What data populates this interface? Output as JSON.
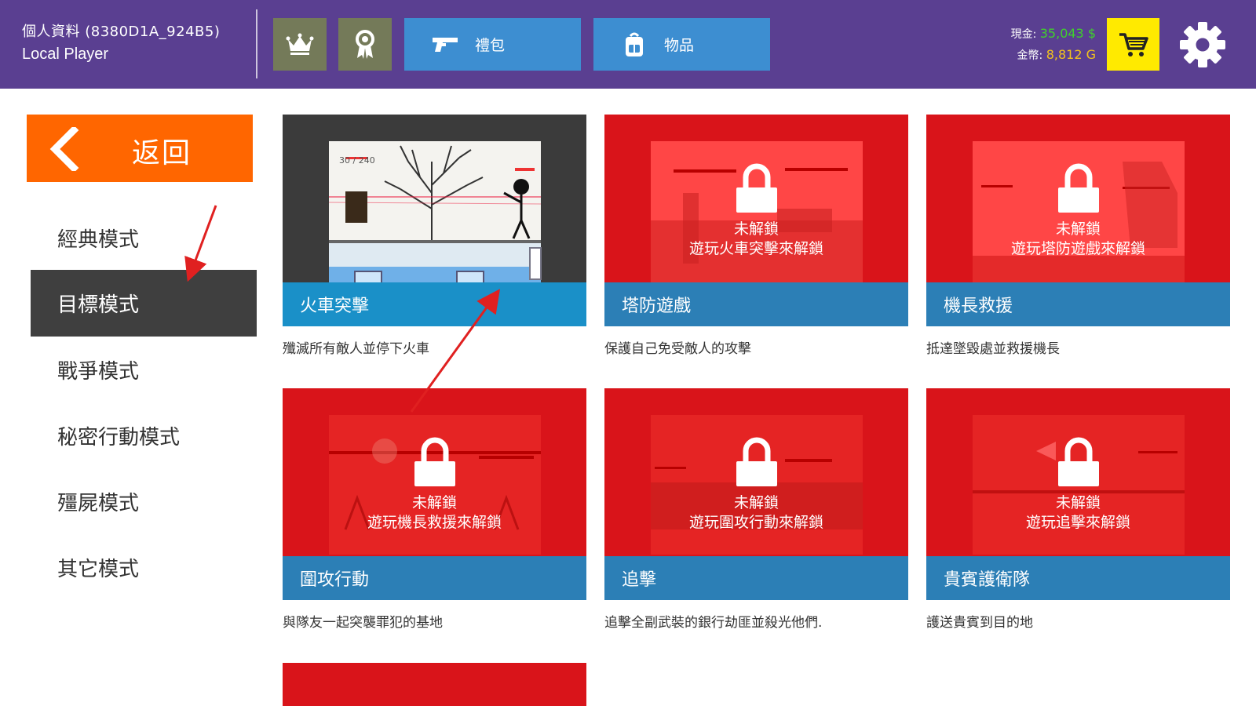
{
  "header": {
    "profile_id": "個人資料 (8380D1A_924B5)",
    "player_name": "Local Player",
    "btn_gift": "禮包",
    "btn_items": "物品",
    "cash_label": "現金:",
    "cash_value": "35,043 $",
    "gold_label": "金幣:",
    "gold_value": "8,812 G"
  },
  "sidebar": {
    "back_label": "返回",
    "items": [
      "經典模式",
      "目標模式",
      "戰爭模式",
      "秘密行動模式",
      "殭屍模式",
      "其它模式"
    ]
  },
  "cards": [
    {
      "title": "火車突擊",
      "desc": "殲滅所有敵人並停下火車",
      "locked": false,
      "art_label": "30 / 240"
    },
    {
      "title": "塔防遊戲",
      "desc": "保護自己免受敵人的攻擊",
      "locked": true,
      "lock_line1": "未解鎖",
      "lock_line2": "遊玩火車突擊來解鎖"
    },
    {
      "title": "機長救援",
      "desc": "抵達墜毀處並救援機長",
      "locked": true,
      "lock_line1": "未解鎖",
      "lock_line2": "遊玩塔防遊戲來解鎖"
    },
    {
      "title": "圍攻行動",
      "desc": "與隊友一起突襲罪犯的基地",
      "locked": true,
      "lock_line1": "未解鎖",
      "lock_line2": "遊玩機長救援來解鎖"
    },
    {
      "title": "追擊",
      "desc": "追擊全副武裝的銀行劫匪並殺光他們.",
      "locked": true,
      "lock_line1": "未解鎖",
      "lock_line2": "遊玩圍攻行動來解鎖"
    },
    {
      "title": "貴賓護衛隊",
      "desc": "護送貴賓到目的地",
      "locked": true,
      "lock_line1": "未解鎖",
      "lock_line2": "遊玩追擊來解鎖"
    }
  ],
  "colors": {
    "header_bg": "#5a3f91",
    "back_orange": "#ff6600",
    "active_nav": "#3f3f3f",
    "locked_red": "#d9141a",
    "caption_blue": "#2c7fb6",
    "cart_yellow": "#ffea00"
  },
  "icons": [
    "crown-icon",
    "ribbon-award-icon",
    "pistol-icon",
    "backpack-icon",
    "cart-icon",
    "gear-icon",
    "padlock-icon",
    "chevron-left-icon"
  ]
}
